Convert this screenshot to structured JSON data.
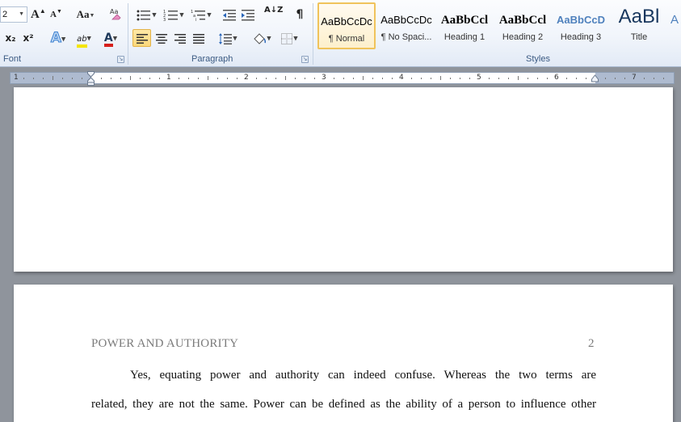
{
  "font_group": {
    "font_size": "2",
    "label": "Font",
    "grow_font": "A",
    "shrink_font": "A",
    "change_case": "Aa",
    "subscript": "x₂",
    "superscript": "x²",
    "text_effects": "A",
    "highlight": "ab",
    "font_color": "A",
    "colors": {
      "highlight": "#f4e500",
      "font_color": "#d6201c"
    }
  },
  "paragraph_group": {
    "label": "Paragraph",
    "show_marks": "¶",
    "sort": "A↓Z"
  },
  "styles_group": {
    "label": "Styles",
    "items": [
      {
        "preview": "AaBbCcDc",
        "name": "¶ Normal"
      },
      {
        "preview": "AaBbCcDc",
        "name": "¶ No Spaci..."
      },
      {
        "preview": "AaBbCcl",
        "name": "Heading 1"
      },
      {
        "preview": "AaBbCcl",
        "name": "Heading 2"
      },
      {
        "preview": "AaBbCcD",
        "name": "Heading 3"
      },
      {
        "preview": "AaBl",
        "name": "Title"
      },
      {
        "preview": "A",
        "name": ""
      }
    ],
    "colors": {
      "heading3": "#4f81bd",
      "title": "#17365d",
      "subtitle": "#4f81bd"
    }
  },
  "ruler": {
    "numbers": [
      "1",
      "1",
      "2",
      "3",
      "4",
      "5",
      "6",
      "7"
    ]
  },
  "document": {
    "running_head": "POWER AND AUTHORITY",
    "page_number": "2",
    "line1": "Yes, equating power and authority can indeed confuse. Whereas the two terms are",
    "line2": "related, they are not the same.  Power can be defined as the ability of a person to influence other"
  }
}
